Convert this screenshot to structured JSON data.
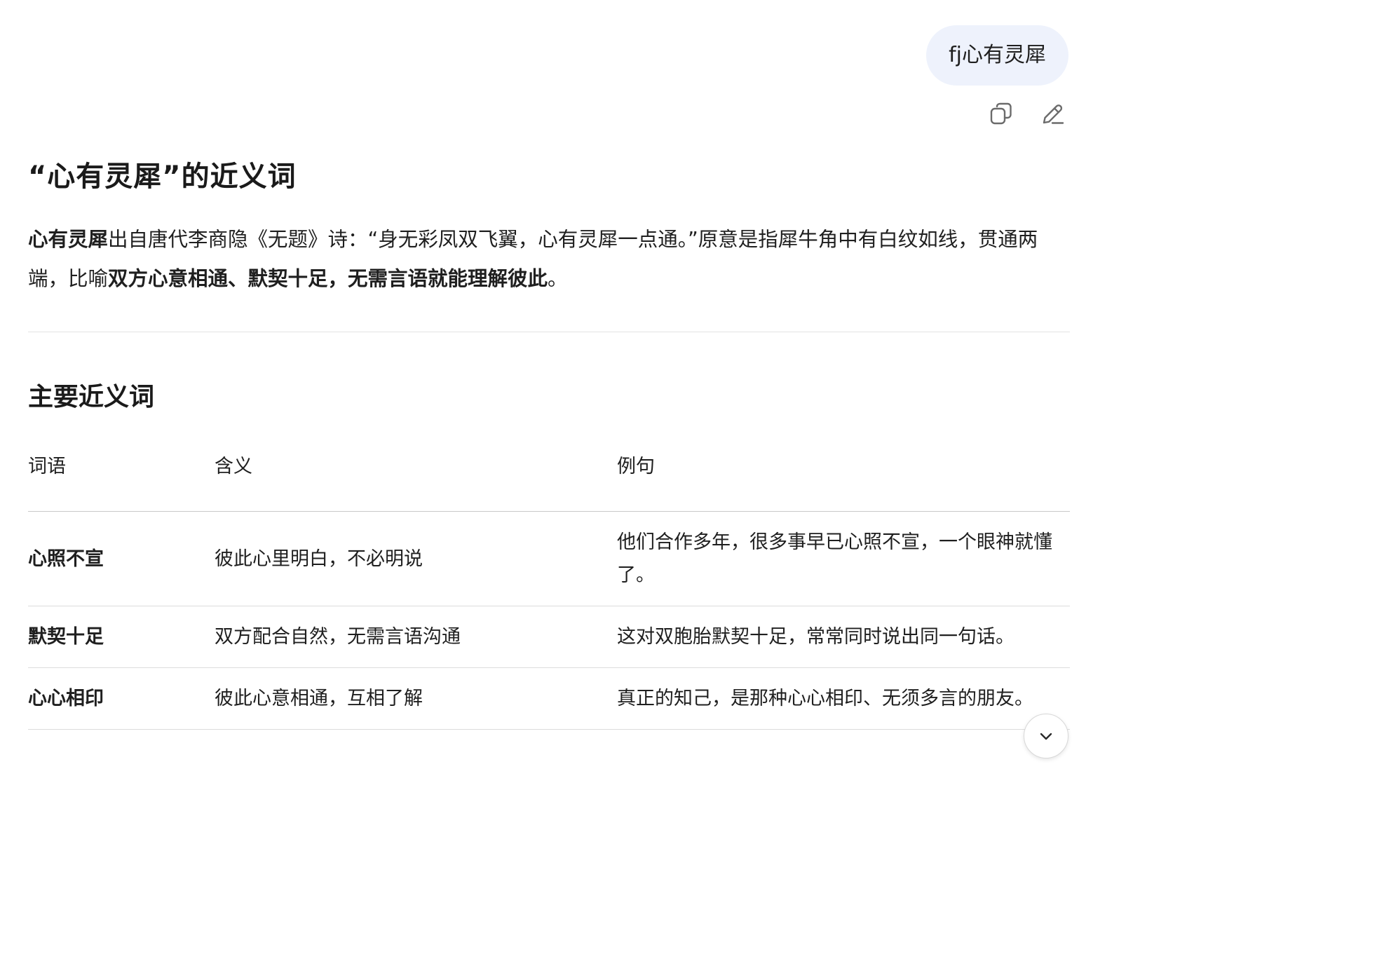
{
  "user_message": "fj心有灵犀",
  "message_actions": {
    "copy_icon": "copy-icon",
    "edit_icon": "pencil-icon"
  },
  "answer": {
    "title": "“心有灵犀”的近义词",
    "intro": {
      "term": "心有灵犀",
      "text_1": "出自唐代李商隐《无题》诗：“身无彩凤双飞翼，心有灵犀一点通。”原意是指犀牛角中有白纹如线，贯通两端，比喻",
      "bold": "双方心意相通、默契十足，无需言语就能理解彼此",
      "end": "。"
    },
    "section_title": "主要近义词",
    "table": {
      "headers": [
        "词语",
        "含义",
        "例句"
      ],
      "rows": [
        [
          "心照不宣",
          "彼此心里明白，不必明说",
          "他们合作多年，很多事早已心照不宣，一个眼神就懂了。"
        ],
        [
          "默契十足",
          "双方配合自然，无需言语沟通",
          "这对双胞胎默契十足，常常同时说出同一句话。"
        ],
        [
          "心心相印",
          "彼此心意相通，互相了解",
          "真正的知己，是那种心心相印、无须多言的朋友。"
        ]
      ]
    }
  },
  "scroll_button_icon": "chevron-down-icon",
  "colors": {
    "user_bubble_bg": "#eef2fc",
    "text": "#1a1a1a",
    "icon": "#6b6b6b",
    "divider": "#e3e3e3"
  }
}
